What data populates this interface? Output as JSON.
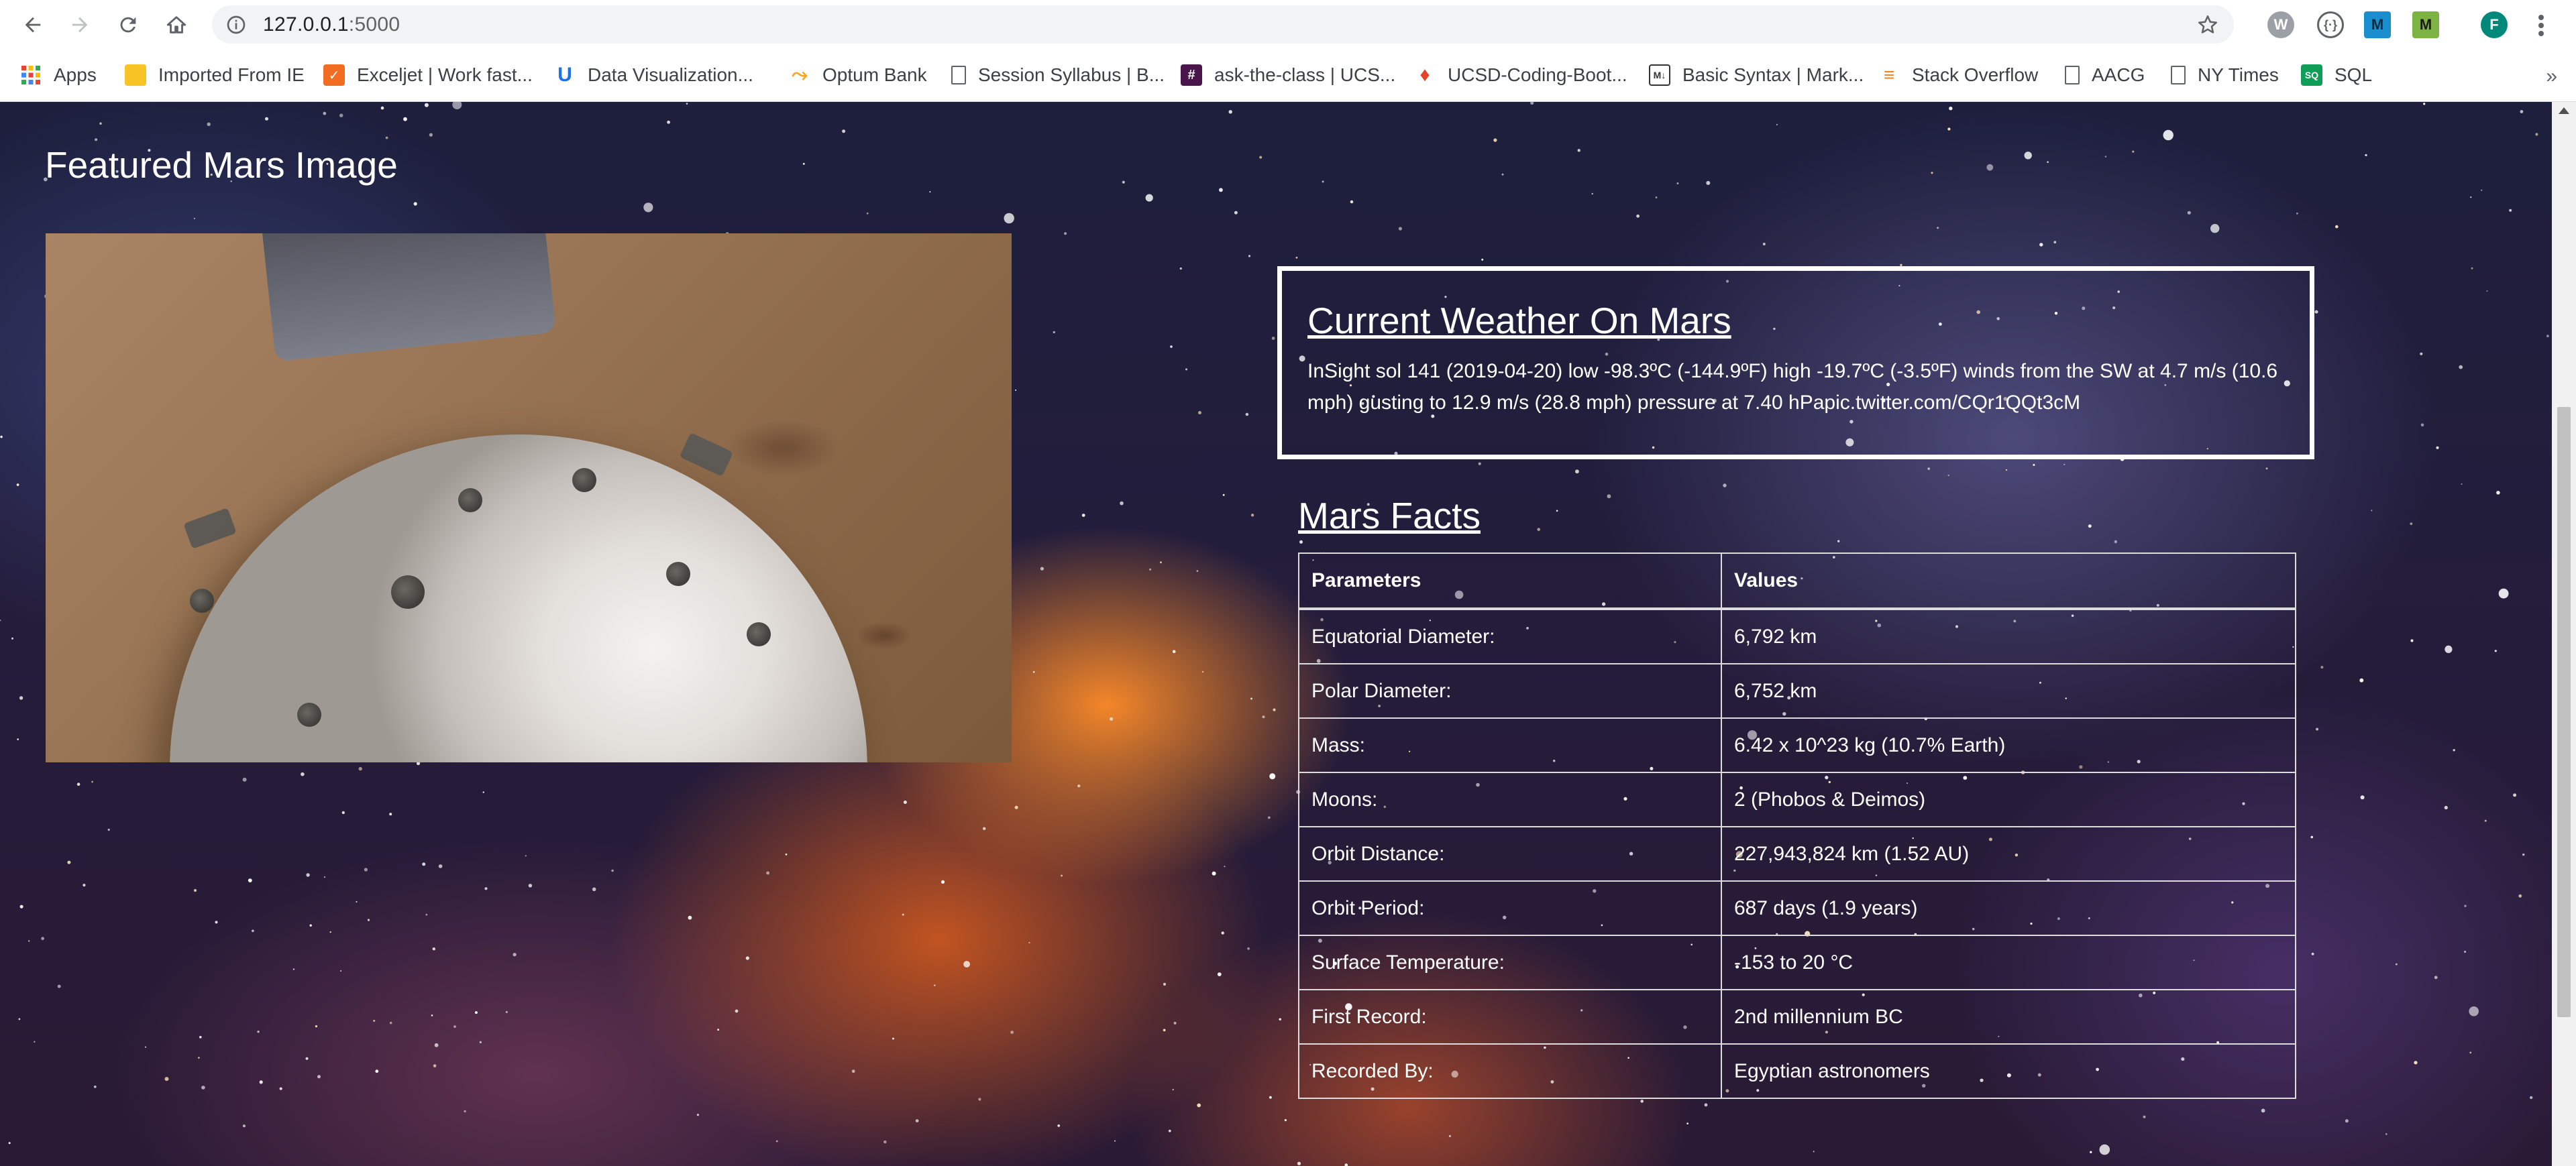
{
  "browser": {
    "url_host": "127.0.0.1",
    "url_port": ":5000",
    "profile_initial": "F"
  },
  "bookmarks": [
    {
      "label": "Apps",
      "icon": "apps-grid-icon",
      "color": "#ea4335"
    },
    {
      "label": "Imported From IE",
      "icon": "folder-icon",
      "color": "#f7c325"
    },
    {
      "label": "Exceljet | Work fast...",
      "icon": "exceljet-icon",
      "color": "#f26d21"
    },
    {
      "label": "Data Visualization...",
      "icon": "ucsd-icon",
      "color": "#1a73e8"
    },
    {
      "label": "Optum Bank",
      "icon": "optum-icon",
      "color": "#f5a623"
    },
    {
      "label": "Session Syllabus | B...",
      "icon": "page-icon",
      "color": "#5f6368"
    },
    {
      "label": "ask-the-class | UCS...",
      "icon": "slack-icon",
      "color": "#4a154b"
    },
    {
      "label": "UCSD-Coding-Boot...",
      "icon": "gitlab-icon",
      "color": "#e24329"
    },
    {
      "label": "Basic Syntax | Mark...",
      "icon": "markdown-icon",
      "color": "#333333"
    },
    {
      "label": "Stack Overflow",
      "icon": "stackoverflow-icon",
      "color": "#f48024"
    },
    {
      "label": "AACG",
      "icon": "page-icon",
      "color": "#5f6368"
    },
    {
      "label": "NY Times",
      "icon": "page-icon",
      "color": "#5f6368"
    },
    {
      "label": "SQL",
      "icon": "sql-icon",
      "color": "#0f9d58"
    }
  ],
  "featured": {
    "title": "Featured Mars Image"
  },
  "weather": {
    "title": "Current Weather On Mars",
    "text": "InSight sol 141 (2019-04-20) low -98.3ºC (-144.9ºF) high -19.7ºC (-3.5ºF) winds from the SW at 4.7 m/s (10.6 mph) gusting to 12.9 m/s (28.8 mph) pressure at 7.40 hPapic.twitter.com/CQr1QQt3cM"
  },
  "facts": {
    "title": "Mars Facts",
    "headers": [
      "Parameters",
      "Values"
    ],
    "rows": [
      [
        "Equatorial Diameter:",
        "6,792 km"
      ],
      [
        "Polar Diameter:",
        "6,752 km"
      ],
      [
        "Mass:",
        "6.42 x 10^23 kg (10.7% Earth)"
      ],
      [
        "Moons:",
        "2 (Phobos & Deimos)"
      ],
      [
        "Orbit Distance:",
        "227,943,824 km (1.52 AU)"
      ],
      [
        "Orbit Period:",
        "687 days (1.9 years)"
      ],
      [
        "Surface Temperature:",
        "-153 to 20 °C"
      ],
      [
        "First Record:",
        "2nd millennium BC"
      ],
      [
        "Recorded By:",
        "Egyptian astronomers"
      ]
    ]
  }
}
